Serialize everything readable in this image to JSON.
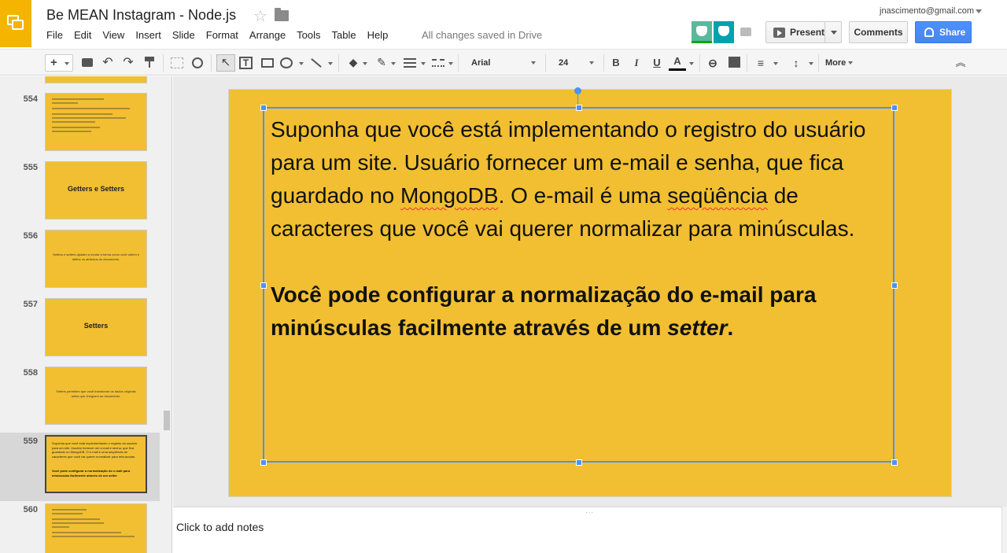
{
  "app": {
    "title": "Be MEAN Instagram - Node.js",
    "save_status": "All changes saved in Drive",
    "user_email": "jnascimento@gmail.com"
  },
  "menu": [
    "File",
    "Edit",
    "View",
    "Insert",
    "Slide",
    "Format",
    "Arrange",
    "Tools",
    "Table",
    "Help"
  ],
  "actions": {
    "present_label": "Present",
    "comments_label": "Comments",
    "share_label": "Share"
  },
  "toolbar": {
    "new_slide": "+",
    "font": "Arial",
    "size": "24",
    "bold": "B",
    "italic": "I",
    "underline": "U",
    "text_color": "A",
    "more": "More"
  },
  "icons": {
    "undo": "↶",
    "redo": "↷",
    "select": "↖",
    "textbox": "T",
    "fill": "◆",
    "border_color": "✎",
    "link": "⊖",
    "align": "≡",
    "line_spacing": "↕",
    "collapse": "︽",
    "star": "☆",
    "notes_grip": "···"
  },
  "slides": [
    {
      "number": "554"
    },
    {
      "number": "555",
      "title": "Getters e Setters"
    },
    {
      "number": "556",
      "text": "Getters e setters ajudam a mudar a forma como você obtém e define os atributos do documento."
    },
    {
      "number": "557",
      "title": "Setters"
    },
    {
      "number": "558",
      "text": "Setters permitem que você transforme os dados originais antes que cheguem ao documento."
    },
    {
      "number": "559",
      "text": "Suponha que você está implementando o registro do usuário para um site. Usuário fornecer um e-mail e senha, que fica guardado no MongoDB. O e-mail é uma seqüência de caracteres que você vai querer normalizar para minúsculas.",
      "bold": "Você pode configurar a normalização do e-mail para minúsculas facilmente através de um setter"
    },
    {
      "number": "560"
    }
  ],
  "current_slide": {
    "p1_a": "Suponha que você está implementando o registro do usuário para um site. Usuário fornecer um e-mail e senha, que fica guardado no ",
    "p1_spell1": "MongoDB",
    "p1_b": ". O e-mail é uma ",
    "p1_spell2": "seqüência",
    "p1_c": " de caracteres que você vai querer normalizar para minúsculas.",
    "p2_a": "Você pode configurar a normalização do e-mail para minúsculas facilmente através de um ",
    "p2_italic": "setter",
    "p2_b": "."
  },
  "notes": {
    "placeholder": "Click to add notes"
  },
  "colors": {
    "slide_background": "#f1bf31",
    "selection": "#4d90fe",
    "share": "#4d90fe",
    "logo": "#f4b400"
  }
}
